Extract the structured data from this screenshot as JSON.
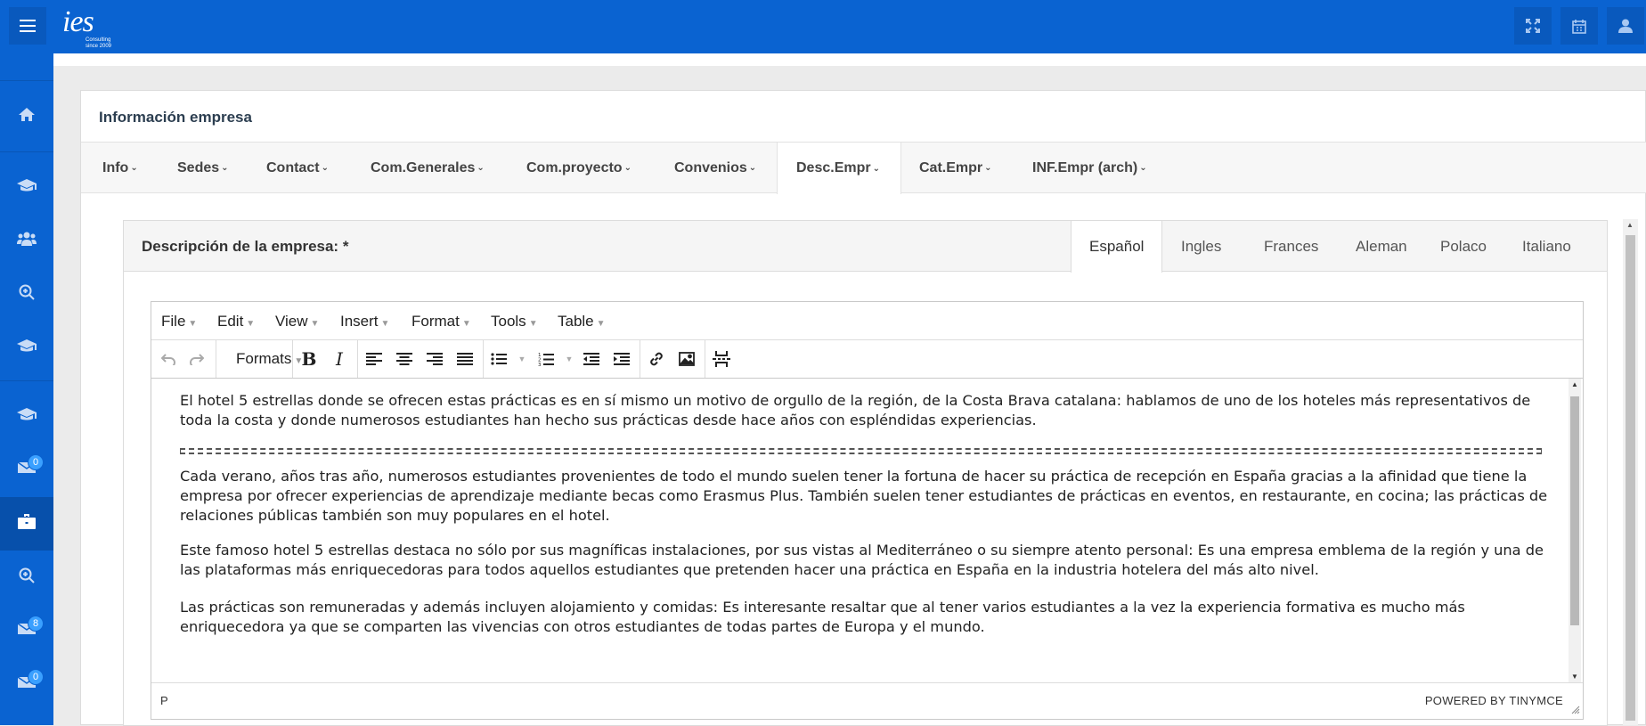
{
  "topbar": {
    "logo_text": "ies",
    "logo_sub": "Consulting since 2009",
    "icons": [
      "expand-icon",
      "calendar-icon",
      "user-icon"
    ]
  },
  "sidebar": {
    "items": [
      {
        "icon": "home-icon"
      },
      {
        "icon": "graduation-cap-icon"
      },
      {
        "icon": "users-icon"
      },
      {
        "icon": "search-plus-icon"
      },
      {
        "icon": "graduation-cap-icon"
      },
      {
        "icon": "graduation-cap-icon"
      },
      {
        "icon": "envelope-icon",
        "badge": "0"
      },
      {
        "icon": "briefcase-icon",
        "active": true
      },
      {
        "icon": "search-plus-icon"
      },
      {
        "icon": "envelope-icon",
        "badge": "8"
      },
      {
        "icon": "envelope-icon",
        "badge": "0"
      }
    ]
  },
  "card": {
    "title": "Información empresa",
    "tabs": [
      "Info",
      "Sedes",
      "Contact",
      "Com.Generales",
      "Com.proyecto",
      "Convenios",
      "Desc.Empr",
      "Cat.Empr",
      "INF.Empr (arch)"
    ],
    "active_tab": "Desc.Empr"
  },
  "panel": {
    "title": "Descripción de la empresa: *",
    "languages": [
      "Español",
      "Ingles",
      "Frances",
      "Aleman",
      "Polaco",
      "Italiano"
    ],
    "active_language": "Español"
  },
  "editor": {
    "menu": [
      "File",
      "Edit",
      "View",
      "Insert",
      "Format",
      "Tools",
      "Table"
    ],
    "formats_label": "Formats",
    "paragraphs": [
      "El hotel 5 estrellas donde se ofrecen estas prácticas es en sí mismo un motivo de orgullo de la región, de la Costa Brava catalana: hablamos de uno de los hoteles más representativos de toda la costa y donde numerosos estudiantes han hecho sus prácticas desde hace años con espléndidas experiencias.",
      "Cada verano, años tras año, numerosos estudiantes provenientes de todo el mundo suelen tener la fortuna de hacer su práctica de recepción en España gracias a la afinidad que tiene la empresa por ofrecer experiencias de aprendizaje mediante becas como Erasmus Plus. También suelen tener estudiantes de prácticas en eventos, en restaurante, en cocina; las prácticas de relaciones públicas también son muy populares en el hotel.",
      "Este famoso hotel 5 estrellas destaca no sólo por sus magníficas instalaciones, por sus vistas al Mediterráneo o su siempre atento personal: Es una empresa emblema de la región y una de las plataformas más enriquecedoras para todos aquellos estudiantes que pretenden hacer una práctica en España en la industria hotelera del más alto nivel.",
      "Las prácticas son remuneradas y además incluyen alojamiento y comidas: Es interesante resaltar que al tener varios estudiantes a la vez la experiencia formativa es mucho más enriquecedora ya que se comparten las vivencias con otros estudiantes de todas partes de Europa y el mundo."
    ],
    "status_path": "P",
    "powered_by": "POWERED BY TINYMCE"
  }
}
